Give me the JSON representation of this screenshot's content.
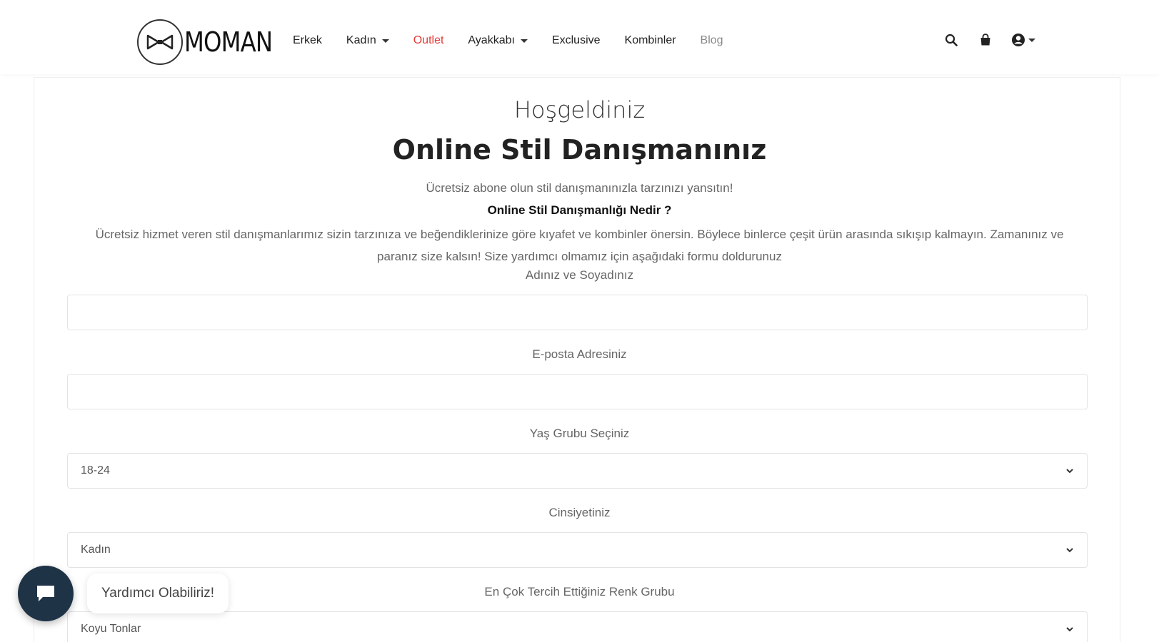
{
  "brand": {
    "name": "MOMAN"
  },
  "nav": {
    "items": [
      {
        "label": "Erkek",
        "dropdown": false
      },
      {
        "label": "Kadın",
        "dropdown": true
      },
      {
        "label": "Outlet",
        "dropdown": false
      },
      {
        "label": "Ayakkabı",
        "dropdown": true
      },
      {
        "label": "Exclusive",
        "dropdown": false
      },
      {
        "label": "Kombinler",
        "dropdown": false
      },
      {
        "label": "Blog",
        "dropdown": false
      }
    ],
    "accent_color": "#e53935"
  },
  "header_icons": [
    "search-icon",
    "bag-icon",
    "user-icon"
  ],
  "form": {
    "welcome": "Hoşgeldiniz",
    "title": "Online Stil Danışmanınız",
    "subtitle": "Ücretsiz abone olun stil danışmanınızla tarzınızı yansıtın!",
    "question": "Online Stil Danışmanlığı Nedir ?",
    "description": "Ücretsiz hizmet veren stil danışmanlarımız sizin tarzınıza ve beğendiklerinize göre kıyafet ve kombinler önersin. Böylece binlerce çeşit ürün arasında sıkışıp kalmayın. Zamanınız ve paranız size kalsın! Size yardımcı olmamız için aşağıdaki formu doldurunuz",
    "name_label": "Adınız ve Soyadınız",
    "name_value": "",
    "email_label": "E-posta Adresiniz",
    "email_value": "",
    "age_label": "Yaş Grubu Seçiniz",
    "age_value": "18-24",
    "gender_label": "Cinsiyetiniz",
    "gender_value": "Kadın",
    "color_label": "En Çok Tercih Ettiğiniz Renk Grubu",
    "color_value": "Koyu Tonlar"
  },
  "chat": {
    "message": "Yardımcı Olabiliriz!",
    "button_color": "#1f3346"
  }
}
